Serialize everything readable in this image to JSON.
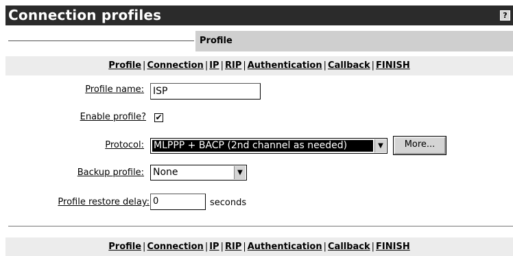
{
  "header": {
    "title": "Connection profiles",
    "help_label": "?"
  },
  "section": {
    "title": "Profile"
  },
  "nav": {
    "items": [
      "Profile",
      "Connection",
      "IP",
      "RIP",
      "Authentication",
      "Callback",
      "FINISH"
    ],
    "separator": "|"
  },
  "form": {
    "profile_name": {
      "label": "Profile name",
      "value": "ISP"
    },
    "enable_profile": {
      "label": "Enable profile?",
      "checked": true,
      "mark": "✔"
    },
    "protocol": {
      "label": "Protocol",
      "value": "MLPPP + BACP (2nd channel as needed)",
      "more_label": "More..."
    },
    "backup_profile": {
      "label": "Backup profile",
      "value": "None"
    },
    "restore_delay": {
      "label": "Profile restore delay",
      "value": "0",
      "unit": "seconds"
    }
  }
}
